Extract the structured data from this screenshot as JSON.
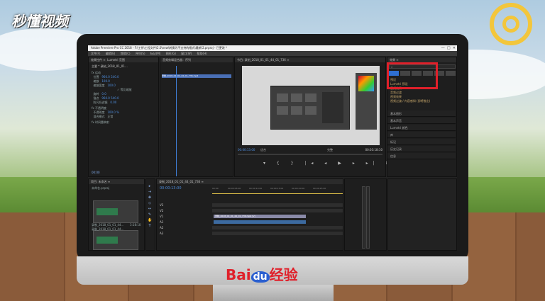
{
  "watermark": {
    "brand": "秒懂视频"
  },
  "footer_logo": {
    "bai": "Bai",
    "du": "du",
    "jingyan": "经验"
  },
  "app": {
    "title": "Adobe Premiere Pro CC 2018 - F:\\工作\\工程文件\\2.0\\new\\转换为不支持的格式\\最新\\2.prproj - 已更改 *",
    "menu": [
      "文件(F)",
      "编辑(E)",
      "剪辑(C)",
      "序列(S)",
      "标记(M)",
      "图形(G)",
      "窗口(W)",
      "帮助(H)"
    ]
  },
  "effect_controls": {
    "tabs": [
      "效果控件 ≡",
      "Lumetri 范围",
      "源：(无剪辑)",
      "音频剪辑混合器：序列"
    ],
    "clip_label": "主要 * 录制_2018_01_01...",
    "seq_label": "序列 01 * 录制_2018_01_01_09_...",
    "timecode": "00:00",
    "rows": [
      {
        "label": "fx 运动",
        "value": ""
      },
      {
        "label": "位置",
        "value": "960.0    540.0"
      },
      {
        "label": "缩放",
        "value": "100.0"
      },
      {
        "label": "缩放宽度",
        "value": "100.0"
      },
      {
        "label": "✓ 等比缩放",
        "value": ""
      },
      {
        "label": "旋转",
        "value": "0.0"
      },
      {
        "label": "锚点",
        "value": "960.0    540.0"
      },
      {
        "label": "防闪烁滤镜",
        "value": "0.00"
      },
      {
        "label": "fx 不透明度",
        "value": ""
      },
      {
        "label": "不透明度",
        "value": "100.0 %"
      },
      {
        "label": "混合模式",
        "value": "正常"
      },
      {
        "label": "fx 时间重映射",
        "value": ""
      }
    ],
    "clip_bar": "录制_2018_01_01_44_01_736.mp4"
  },
  "program": {
    "title": "节目: 录制_2018_01_01_44_01_736 ≡",
    "timecode": "00:00:13:00",
    "fit": "适合",
    "ratio": "完整",
    "duration": "00:03:18:10"
  },
  "right_panel": {
    "search_placeholder": "⌕",
    "rows": [
      "预设",
      "Lumetri 预设",
      "音频效果",
      "音频过渡",
      "视频效果",
      "视频过渡 / 内容感知 (即将推出)"
    ],
    "items": [
      "基本图形",
      "基本声音",
      "Lumetri 颜色",
      "库",
      "标记",
      "历史记录",
      "信息"
    ]
  },
  "project": {
    "tab": "项目: 未命名 ≡",
    "file_label": "未命名.prproj",
    "thumbs": [
      {
        "label": "录制_2018_01_01_44...",
        "duration": "3:18:10"
      },
      {
        "label": "录制_2018_01_01_44...",
        "duration": ""
      }
    ]
  },
  "timeline": {
    "tab": "录制_2018_01_01_44_01_736 ≡",
    "timecode": "00:00:13:00",
    "ruler": [
      "00:00",
      "00:00:05:00",
      "00:00:10:00",
      "00:00:15:00",
      "00:00:20:00",
      "00:00:25:00"
    ],
    "tracks": [
      "V3",
      "V2",
      "V1",
      "A1",
      "A2",
      "A3"
    ],
    "video_clip": "录制_2018_01_01_44_01_736.mp4 [V]",
    "audio_clip": ""
  }
}
